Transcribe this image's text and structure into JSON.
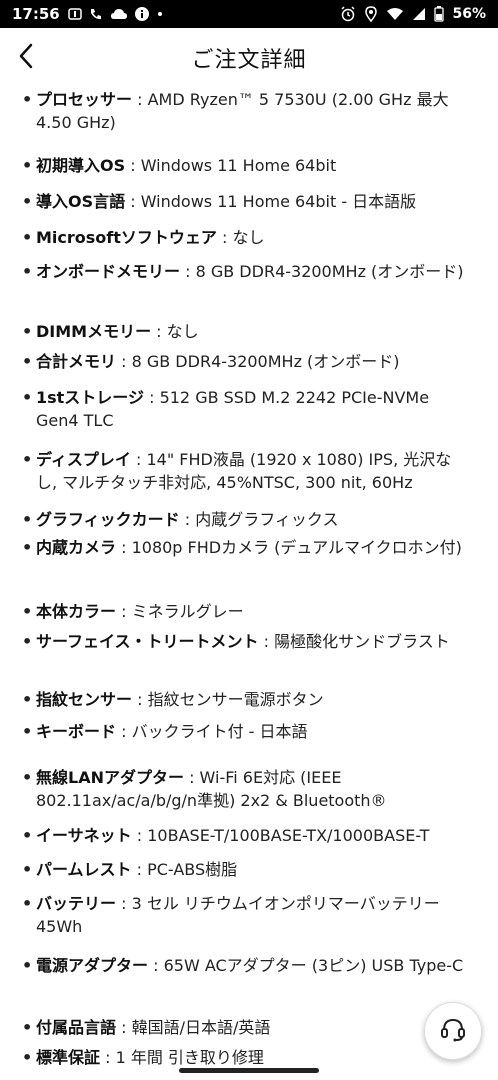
{
  "status_bar": {
    "time": "17:56",
    "battery": "56%",
    "left_icons": [
      "sim-icon",
      "phone-signal-icon",
      "cloud-icon",
      "info-icon",
      "dot-icon"
    ],
    "right_icons": [
      "alarm-icon",
      "location-icon",
      "wifi-icon",
      "cell-signal-icon",
      "battery-icon"
    ]
  },
  "header": {
    "title": "ご注文詳細",
    "back_icon": "chevron-left-icon"
  },
  "specs": [
    {
      "label": "プロセッサー",
      "sep": " : ",
      "value": "AMD Ryzen™ 5 7530U (2.00 GHz 最大 4.50 GHz)"
    },
    {
      "label": "初期導入OS",
      "sep": " : ",
      "value": "Windows 11 Home 64bit"
    },
    {
      "label": "導入OS言語",
      "sep": " : ",
      "value": "Windows 11 Home 64bit - 日本語版"
    },
    {
      "label": "Microsoftソフトウェア",
      "sep": " : ",
      "value": "なし"
    },
    {
      "label": "オンボードメモリー",
      "sep": " : ",
      "value": "8 GB DDR4-3200MHz (オンボード)"
    },
    {
      "label": "DIMMメモリー",
      "sep": " : ",
      "value": "なし"
    },
    {
      "label": "合計メモリ",
      "sep": " : ",
      "value": "8 GB DDR4-3200MHz (オンボード)"
    },
    {
      "label": "1stストレージ",
      "sep": " : ",
      "value": "512 GB SSD M.2 2242 PCIe-NVMe Gen4 TLC"
    },
    {
      "label": "ディスプレイ",
      "sep": " : ",
      "value": "14\" FHD液晶 (1920 x 1080) IPS, 光沢なし, マルチタッチ非対応, 45%NTSC, 300 nit, 60Hz"
    },
    {
      "label": "グラフィックカード",
      "sep": " : ",
      "value": "内蔵グラフィックス"
    },
    {
      "label": "内蔵カメラ",
      "sep": " : ",
      "value": "1080p FHDカメラ (デュアルマイクロホン付)"
    },
    {
      "label": "本体カラー",
      "sep": " : ",
      "value": "ミネラルグレー"
    },
    {
      "label": "サーフェイス・トリートメント",
      "sep": " : ",
      "value": "陽極酸化サンドブラスト"
    },
    {
      "label": "指紋センサー",
      "sep": " : ",
      "value": "指紋センサー電源ボタン"
    },
    {
      "label": "キーボード",
      "sep": " : ",
      "value": "バックライト付 - 日本語"
    },
    {
      "label": "無線LANアダプター",
      "sep": " : ",
      "value": "Wi-Fi 6E対応 (IEEE 802.11ax/ac/a/b/g/n準拠) 2x2 & Bluetooth®"
    },
    {
      "label": "イーサネット",
      "sep": " : ",
      "value": "10BASE-T/100BASE-TX/1000BASE-T"
    },
    {
      "label": "パームレスト",
      "sep": " : ",
      "value": "PC-ABS樹脂"
    },
    {
      "label": "バッテリー",
      "sep": " : ",
      "value": "3 セル リチウムイオンポリマーバッテリー 45Wh"
    },
    {
      "label": "電源アダプター",
      "sep": " : ",
      "value": "65W ACアダプター (3ピン) USB Type-C"
    },
    {
      "label": "付属品言語",
      "sep": " : ",
      "value": "韓国語/日本語/英語"
    },
    {
      "label": "標準保証",
      "sep": " : ",
      "value": "1 年間 引き取り修理"
    }
  ],
  "support_button": {
    "icon": "headset-icon"
  },
  "colors": {
    "text": "#222222",
    "status_bar_bg": "#000000",
    "background": "#ffffff"
  }
}
